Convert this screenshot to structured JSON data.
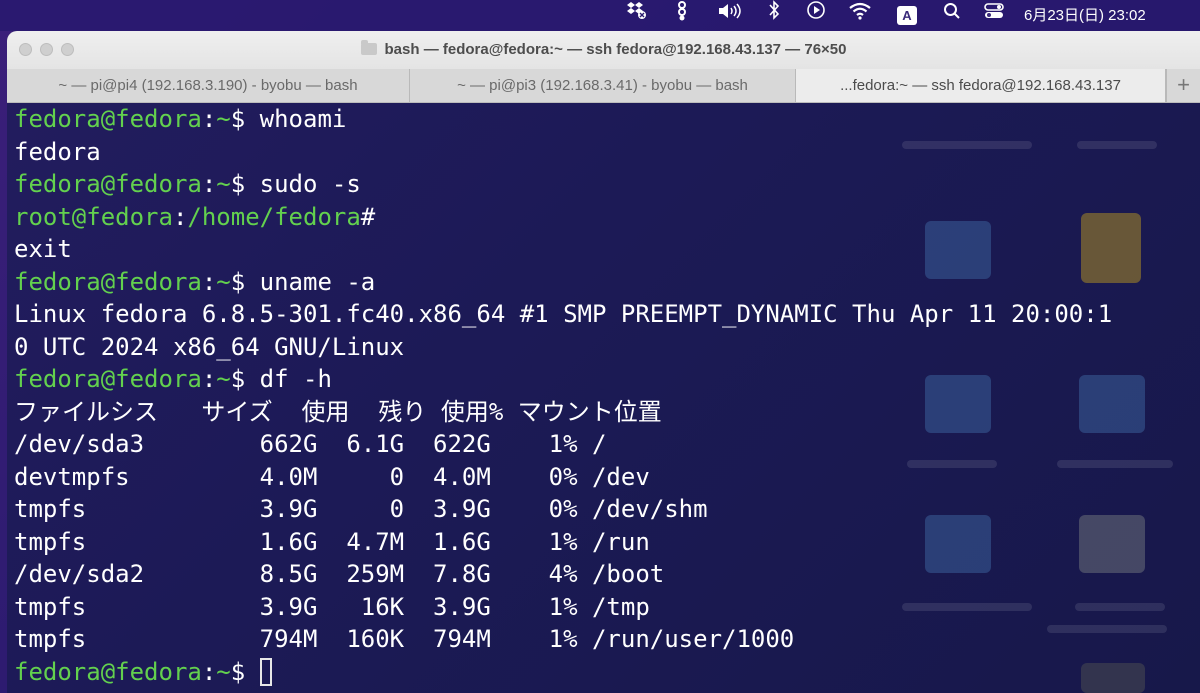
{
  "menubar": {
    "icons": [
      "dropbox-icon",
      "bartender-icon",
      "volume-icon",
      "bluetooth-icon",
      "play-icon",
      "wifi-icon",
      "input-source-icon",
      "spotlight-search-icon",
      "control-center-icon"
    ],
    "input_source": "A",
    "clock": "6月23日(日) 23:02"
  },
  "window": {
    "title": "bash — fedora@fedora:~ — ssh fedora@192.168.43.137 — 76×50",
    "tabs": [
      {
        "label": "~ — pi@pi4 (192.168.3.190) - byobu — bash",
        "active": false
      },
      {
        "label": "~ — pi@pi3 (192.168.3.41) - byobu — bash",
        "active": false
      },
      {
        "label": "...fedora:~ — ssh fedora@192.168.43.137",
        "active": true
      }
    ],
    "new_tab_label": "+"
  },
  "terminal": {
    "lines": [
      {
        "prompt": "fedora@fedora",
        "sep": ":",
        "path": "~",
        "sym": "$",
        "cmd": " whoami"
      },
      {
        "text": "fedora"
      },
      {
        "prompt": "fedora@fedora",
        "sep": ":",
        "path": "~",
        "sym": "$",
        "cmd": " sudo -s"
      },
      {
        "prompt": "root@fedora",
        "sep": ":",
        "path": "/home/fedora",
        "sym": "#",
        "cmd": ""
      },
      {
        "text": "exit"
      },
      {
        "prompt": "fedora@fedora",
        "sep": ":",
        "path": "~",
        "sym": "$",
        "cmd": " uname -a"
      },
      {
        "text": "Linux fedora 6.8.5-301.fc40.x86_64 #1 SMP PREEMPT_DYNAMIC Thu Apr 11 20:00:1"
      },
      {
        "text": "0 UTC 2024 x86_64 GNU/Linux"
      },
      {
        "prompt": "fedora@fedora",
        "sep": ":",
        "path": "~",
        "sym": "$",
        "cmd": " df -h"
      },
      {
        "text": "ファイルシス   サイズ  使用  残り 使用% マウント位置"
      },
      {
        "text": "/dev/sda3        662G  6.1G  622G    1% /"
      },
      {
        "text": "devtmpfs         4.0M     0  4.0M    0% /dev"
      },
      {
        "text": "tmpfs            3.9G     0  3.9G    0% /dev/shm"
      },
      {
        "text": "tmpfs            1.6G  4.7M  1.6G    1% /run"
      },
      {
        "text": "/dev/sda2        8.5G  259M  7.8G    4% /boot"
      },
      {
        "text": "tmpfs            3.9G   16K  3.9G    1% /tmp"
      },
      {
        "text": "tmpfs            794M  160K  794M    1% /run/user/1000"
      },
      {
        "prompt": "fedora@fedora",
        "sep": ":",
        "path": "~",
        "sym": "$",
        "cmd": " ",
        "cursor": true
      }
    ]
  }
}
